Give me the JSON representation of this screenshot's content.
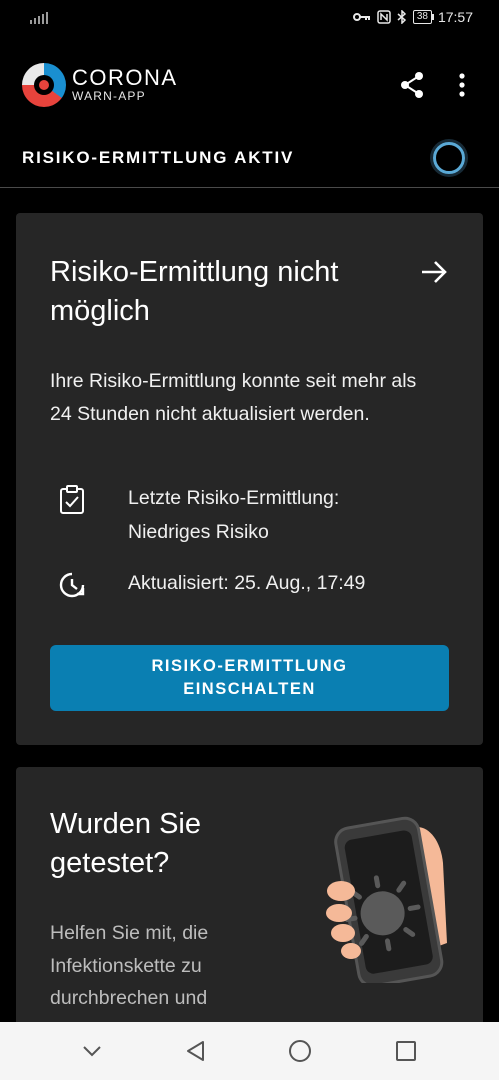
{
  "status_bar": {
    "time": "17:57",
    "battery": "38"
  },
  "app_bar": {
    "logo_title": "CORONA",
    "logo_subtitle": "WARN-APP",
    "icons": [
      "share-icon",
      "more-vert-icon"
    ]
  },
  "risk_header": {
    "label": "RISIKO-ERMITTLUNG AKTIV"
  },
  "risk_card": {
    "title": "Risiko-Ermittlung nicht möglich",
    "body": "Ihre Risiko-Ermittlung konnte seit mehr als 24 Stunden nicht aktualisiert werden.",
    "last_check_line1": "Letzte Risiko-Ermittlung:",
    "last_check_line2": "Niedriges Risiko",
    "updated": "Aktualisiert: 25. Aug., 17:49",
    "button_line1": "RISIKO-ERMITTLUNG",
    "button_line2": "EINSCHALTEN"
  },
  "test_card": {
    "title": "Wurden Sie getestet?",
    "body": "Helfen Sie mit, die Infektionskette zu durchbrechen und"
  },
  "colors": {
    "background": "#000000",
    "card": "#262626",
    "primary_button": "#0a7fb2",
    "accent_ring": "#5aa9d6"
  }
}
